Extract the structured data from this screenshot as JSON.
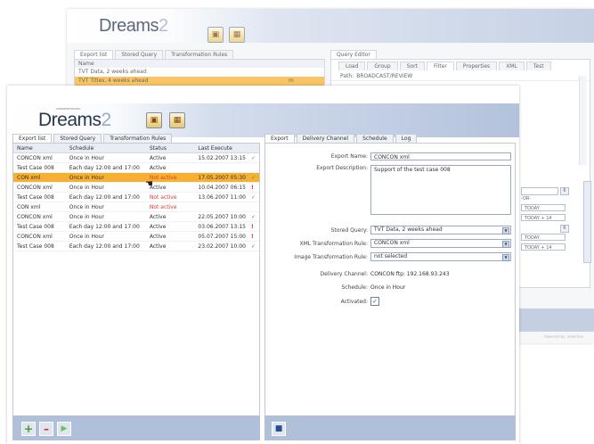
{
  "app": {
    "logo": "Dreams",
    "logo_suffix": "2",
    "tagline": "DATA EXPORT SOLUTION"
  },
  "back": {
    "tabs": [
      "Export list",
      "Stored Query",
      "Transformation Rules"
    ],
    "list_header": "Name",
    "list_rows": [
      "TVT Data, 2 weeks ahead",
      "TVT Titles, 4 weeks ahead"
    ],
    "row_marker": "m",
    "query_editor_tab": "Query Editor",
    "qtabs": [
      "Load",
      "Group",
      "Sort",
      "Filter",
      "Properties",
      "XML",
      "Test"
    ],
    "path_label": "Path:",
    "path_value": "BROADCAST/REVIEW",
    "side_fragments": [
      "6",
      "TODAY",
      "TODAY + 14",
      "-OR-"
    ],
    "powered": "Powered by: Selective"
  },
  "front": {
    "left_tabs": [
      "Export list",
      "Stored Query",
      "Transformation Rules"
    ],
    "columns": [
      "Name",
      "Schedule",
      "Status",
      "Last Execute"
    ],
    "rows": [
      {
        "name": "CONCON xml",
        "schedule": "Once in Hour",
        "status": "Active",
        "last": "15.02.2007 13:15",
        "flag": "✓",
        "na": false,
        "sel": false
      },
      {
        "name": "Test Case 008",
        "schedule": "Each day 12:00 and 17:00",
        "status": "Active",
        "last": "",
        "flag": "",
        "na": false,
        "sel": false
      },
      {
        "name": "CON xml",
        "schedule": "Once in Hour",
        "status": "Not active",
        "last": "17.05.2007 05:30",
        "flag": "✓",
        "na": true,
        "sel": true
      },
      {
        "name": "CONCON xml",
        "schedule": "Once in Hour",
        "status": "Active",
        "last": "10.04.2007 06:15",
        "flag": "!",
        "na": false,
        "sel": false
      },
      {
        "name": "Test Case 008",
        "schedule": "Each day 12:00 and 17:00",
        "status": "Not active",
        "last": "13.06.2007 11:00",
        "flag": "✓",
        "na": true,
        "sel": false
      },
      {
        "name": "CON xml",
        "schedule": "Once in Hour",
        "status": "Not active",
        "last": "",
        "flag": "",
        "na": true,
        "sel": false
      },
      {
        "name": "CONCON xml",
        "schedule": "Once in Hour",
        "status": "Active",
        "last": "22.05.2007 10:00",
        "flag": "✓",
        "na": false,
        "sel": false
      },
      {
        "name": "Test Case 008",
        "schedule": "Each day 12:00 and 17:00",
        "status": "Active",
        "last": "03.06.2007 13:15",
        "flag": "!",
        "na": false,
        "sel": false
      },
      {
        "name": "CONCON xml",
        "schedule": "Once in Hour",
        "status": "Active",
        "last": "05.07.2007 15:00",
        "flag": "!",
        "na": false,
        "sel": false
      },
      {
        "name": "Test Case 008",
        "schedule": "Each day 12:00 and 17:00",
        "status": "Active",
        "last": "23.02.2007 10:00",
        "flag": "✓",
        "na": false,
        "sel": false
      }
    ],
    "right_tabs": [
      "Export",
      "Delivery Channel",
      "Schedule",
      "Log"
    ],
    "form": {
      "export_name_label": "Export Name:",
      "export_name_value": "CONCON xml",
      "export_desc_label": "Export Description:",
      "export_desc_value": "Support of the test case 008",
      "stored_query_label": "Stored Query:",
      "stored_query_value": "TVT Data, 2 weeks ahead",
      "xml_rule_label": "XML Transformation Rule:",
      "xml_rule_value": "CONCON xml",
      "image_rule_label": "Image Transformation Rule:",
      "image_rule_value": "not selected",
      "delivery_label": "Delivery Channel:",
      "delivery_value": "CONCON ftp: 192.168.93.243",
      "schedule_label": "Schedule:",
      "schedule_value": "Once in Hour",
      "activated_label": "Activated:"
    }
  },
  "colors": {
    "selected_row": "#f7b132",
    "footer": "#b1c0d9",
    "not_active": "#e03b2a"
  },
  "icons": [
    "image-icon",
    "document-icon",
    "add-icon",
    "remove-icon",
    "run-icon",
    "save-icon",
    "checkmark-icon",
    "warning-icon",
    "cursor-icon"
  ]
}
